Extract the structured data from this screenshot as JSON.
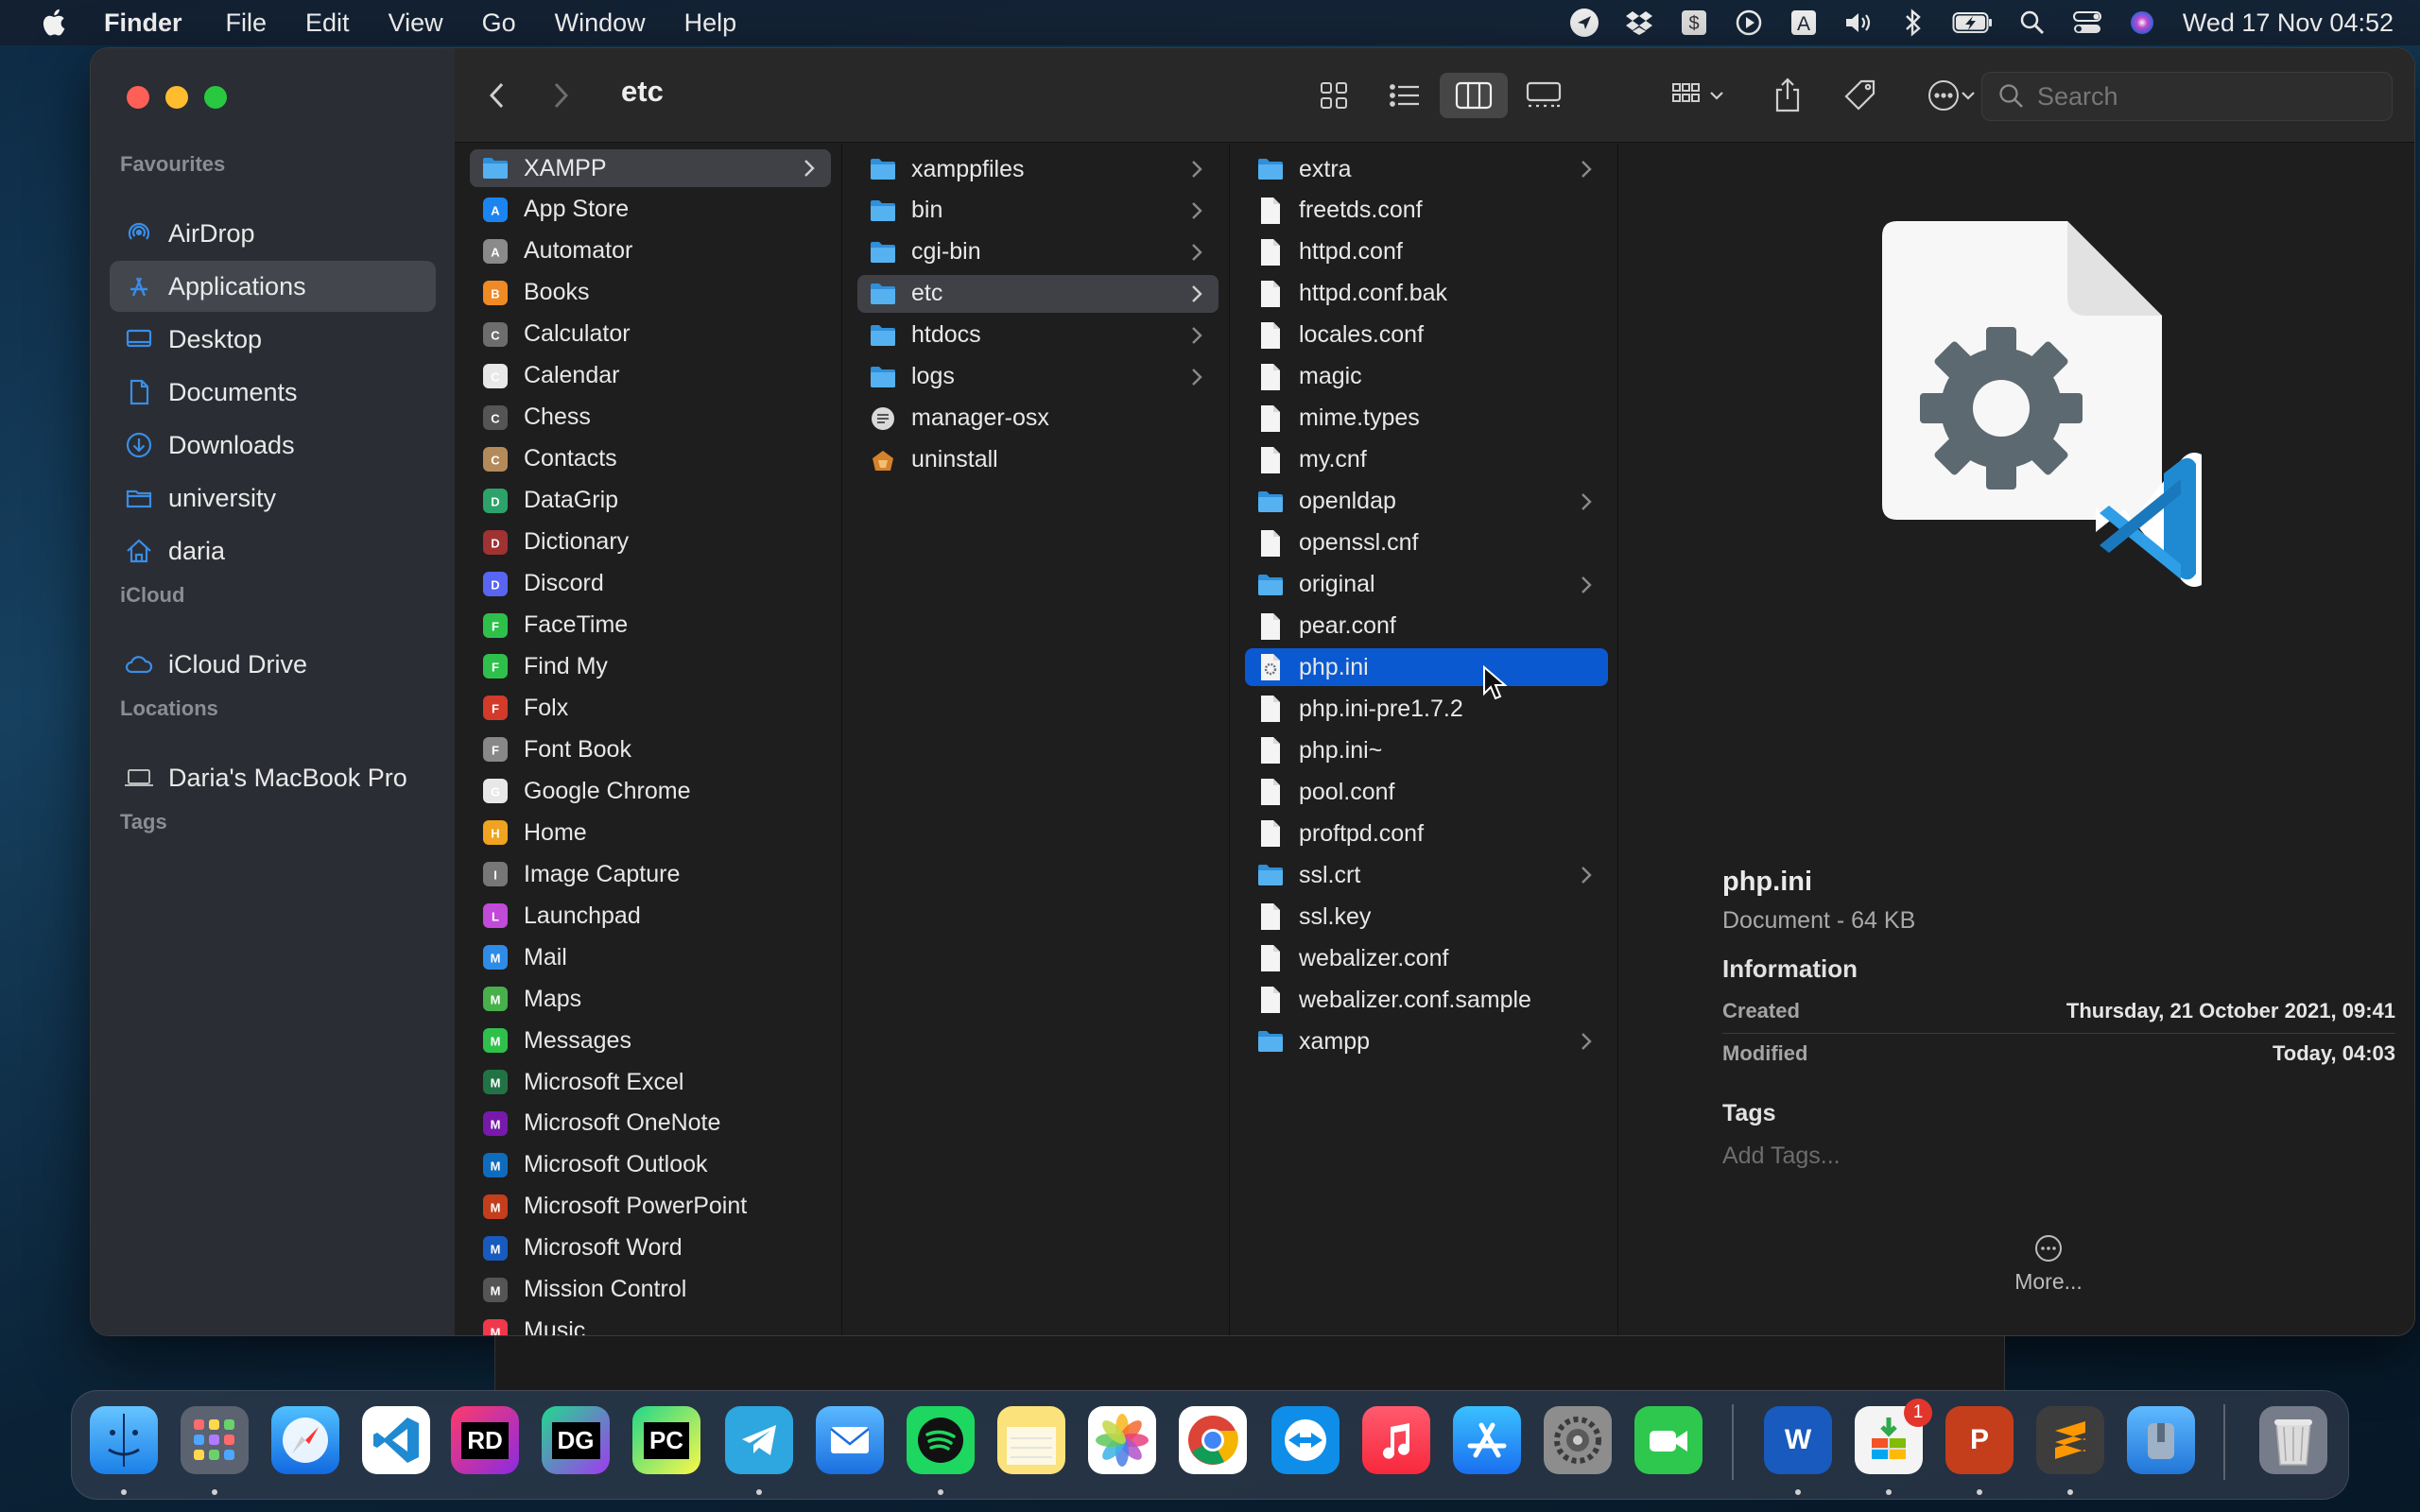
{
  "menubar": {
    "app": "Finder",
    "items": [
      "File",
      "Edit",
      "View",
      "Go",
      "Window",
      "Help"
    ],
    "clock": "Wed 17 Nov  04:52",
    "status_icons": [
      "location-arrow-icon",
      "dropbox-icon",
      "dollar-app-icon",
      "play-circle-icon",
      "input-source-icon",
      "volume-icon",
      "bluetooth-icon",
      "battery-charging-icon",
      "spotlight-search-icon",
      "control-center-icon",
      "siri-icon"
    ]
  },
  "sidebar": {
    "favourites_label": "Favourites",
    "favourites": [
      {
        "label": "AirDrop",
        "icon": "airdrop-icon"
      },
      {
        "label": "Applications",
        "icon": "applications-icon",
        "selected": true
      },
      {
        "label": "Desktop",
        "icon": "desktop-icon"
      },
      {
        "label": "Documents",
        "icon": "documents-icon"
      },
      {
        "label": "Downloads",
        "icon": "downloads-icon"
      },
      {
        "label": "university",
        "icon": "folder-icon"
      },
      {
        "label": "daria",
        "icon": "home-icon"
      }
    ],
    "icloud_label": "iCloud",
    "icloud": [
      {
        "label": "iCloud Drive",
        "icon": "cloud-icon"
      }
    ],
    "locations_label": "Locations",
    "locations": [
      {
        "label": "Daria's MacBook Pro",
        "icon": "laptop-icon"
      }
    ],
    "tags_label": "Tags"
  },
  "toolbar": {
    "title": "etc",
    "search_placeholder": "Search"
  },
  "columns": {
    "applications": [
      "XAMPP",
      "App Store",
      "Automator",
      "Books",
      "Calculator",
      "Calendar",
      "Chess",
      "Contacts",
      "DataGrip",
      "Dictionary",
      "Discord",
      "FaceTime",
      "Find My",
      "Folx",
      "Font Book",
      "Google Chrome",
      "Home",
      "Image Capture",
      "Launchpad",
      "Mail",
      "Maps",
      "Messages",
      "Microsoft Excel",
      "Microsoft OneNote",
      "Microsoft Outlook",
      "Microsoft PowerPoint",
      "Microsoft Word",
      "Mission Control",
      "Music"
    ],
    "xampp": [
      "xamppfiles",
      "bin",
      "cgi-bin",
      "etc",
      "htdocs",
      "logs",
      "manager-osx",
      "uninstall"
    ],
    "etc": [
      "extra",
      "freetds.conf",
      "httpd.conf",
      "httpd.conf.bak",
      "locales.conf",
      "magic",
      "mime.types",
      "my.cnf",
      "openldap",
      "openssl.cnf",
      "original",
      "pear.conf",
      "php.ini",
      "php.ini-pre1.7.2",
      "php.ini~",
      "pool.conf",
      "proftpd.conf",
      "ssl.crt",
      "ssl.key",
      "webalizer.conf",
      "webalizer.conf.sample",
      "xampp"
    ]
  },
  "preview": {
    "name": "php.ini",
    "kind": "Document - 64 KB",
    "information_label": "Information",
    "created_label": "Created",
    "created_value": "Thursday, 21 October 2021, 09:41",
    "modified_label": "Modified",
    "modified_value": "Today, 04:03",
    "tags_label": "Tags",
    "add_tags": "Add Tags...",
    "more": "More..."
  },
  "dock": {
    "items": [
      "Finder",
      "Launchpad",
      "Safari",
      "Visual Studio Code",
      "Rider",
      "DataGrip",
      "PyCharm",
      "Telegram",
      "Mail",
      "Spotify",
      "Notes",
      "Photos",
      "Google Chrome",
      "TeamViewer",
      "Music",
      "App Store",
      "System Preferences",
      "FaceTime",
      "Microsoft Word",
      "Microsoft 365 Installer",
      "Microsoft PowerPoint",
      "Sublime Text",
      "Archive Utility",
      "Trash"
    ],
    "rd_label": "RD",
    "dg_label": "DG",
    "pc_label": "PC",
    "word_label": "W",
    "ppt_label": "P",
    "badge": "1"
  },
  "colors": {
    "selection_blue": "#0b59d1",
    "folder_blue": "#3aa0e8",
    "vscode_blue": "#1f8ad2"
  }
}
